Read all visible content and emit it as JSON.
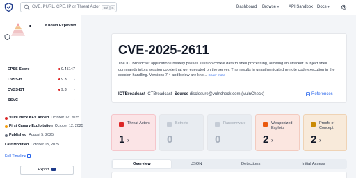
{
  "topbar": {
    "search_placeholder": "CVE, PURL, CPE, IP or Threat Actor",
    "kbd_ctrl": "Ctrl",
    "kbd_k": "K",
    "nav": [
      "Dashboard",
      "Browse",
      "API Sandbox",
      "Docs"
    ]
  },
  "sidebar": {
    "exploit_label": "Known Exploited",
    "metrics": [
      {
        "label": "EPSS Score",
        "value": "0.45147"
      },
      {
        "label": "CVSS-B",
        "value": "9.3"
      },
      {
        "label": "CVSS-BT",
        "value": "9.3"
      },
      {
        "label": "SSVC",
        "value": ""
      }
    ],
    "events": [
      {
        "label": "VulnCheck KEV Added",
        "date": "October 12, 2025"
      },
      {
        "label": "First Canary Exploitation",
        "date": "October 12, 2025"
      },
      {
        "label": "Published",
        "date": "August 5, 2025"
      },
      {
        "label": "Last Modified",
        "date": "October 15, 2025"
      }
    ],
    "timeline_link": "Full Timeline",
    "export_label": "Export"
  },
  "cve": {
    "id": "CVE-2025-2611",
    "description": "The ICTBroadcast application unsafely passes session cookie data to shell processing, allowing an attacker to inject shell commands into a session cookie that get executed on the server. This results in unauthenticated remote code execution in the session handling. Versions 7.4 and below are kno...",
    "show_more": "Show more",
    "vendor": "ICTBroadcast",
    "product": "ICTBroadcast",
    "source_label": "Source",
    "source": "disclosure@vulncheck.com (VulnCheck)",
    "references_label": "References"
  },
  "tiles": [
    {
      "label": "Threat Actors",
      "value": "1",
      "arrow": "›"
    },
    {
      "label": "Botnets",
      "value": "0",
      "arrow": ""
    },
    {
      "label": "Ransomware",
      "value": "0",
      "arrow": ""
    },
    {
      "label": "Weaponized Exploits",
      "value": "2",
      "arrow": "›"
    },
    {
      "label": "Proofs of Concept",
      "value": "2",
      "arrow": "›"
    }
  ],
  "tabs": [
    "Overview",
    "JSON",
    "Detections",
    "Initial Access"
  ],
  "colors": {
    "accent": "#2563eb",
    "danger": "#dc2626",
    "tile_threat": "#fbe4e6",
    "tile_neutral": "#e8ecf1",
    "tile_weaponized": "#fbe6e0",
    "tile_poc": "#f8eada"
  }
}
